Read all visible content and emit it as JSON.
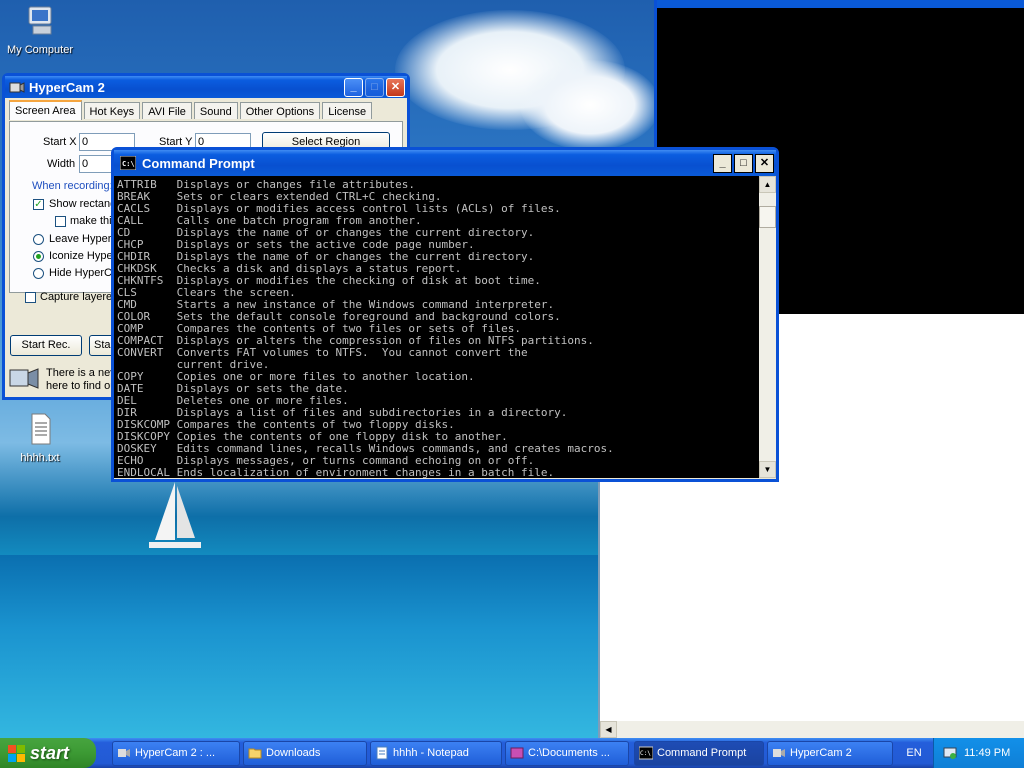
{
  "desktop": {
    "icons": [
      {
        "label": "My Computer"
      },
      {
        "label": "hhhh.txt"
      }
    ]
  },
  "hypercam": {
    "title": "HyperCam 2",
    "tabs": [
      "Screen Area",
      "Hot Keys",
      "AVI File",
      "Sound",
      "Other Options",
      "License"
    ],
    "start_x_label": "Start X",
    "start_x_value": "0",
    "start_y_label": "Start Y",
    "start_y_value": "0",
    "width_label": "Width",
    "width_value": "0",
    "select_region_label": "Select Region",
    "when_recording_label": "When recording:",
    "show_rect_label": "Show rectang",
    "make_this_label": "make this",
    "leave_label": "Leave HyperC",
    "iconize_label": "Iconize Hyper",
    "hide_label": "Hide HyperCa",
    "capture_layered_label": "Capture layered",
    "start_rec_label": "Start Rec.",
    "sta_label": "Sta",
    "notice_line1": "There is a nev",
    "notice_line2": "here to find ou"
  },
  "cmd": {
    "title": "Command Prompt",
    "lines": [
      "ATTRIB   Displays or changes file attributes.",
      "BREAK    Sets or clears extended CTRL+C checking.",
      "CACLS    Displays or modifies access control lists (ACLs) of files.",
      "CALL     Calls one batch program from another.",
      "CD       Displays the name of or changes the current directory.",
      "CHCP     Displays or sets the active code page number.",
      "CHDIR    Displays the name of or changes the current directory.",
      "CHKDSK   Checks a disk and displays a status report.",
      "CHKNTFS  Displays or modifies the checking of disk at boot time.",
      "CLS      Clears the screen.",
      "CMD      Starts a new instance of the Windows command interpreter.",
      "COLOR    Sets the default console foreground and background colors.",
      "COMP     Compares the contents of two files or sets of files.",
      "COMPACT  Displays or alters the compression of files on NTFS partitions.",
      "CONVERT  Converts FAT volumes to NTFS.  You cannot convert the",
      "         current drive.",
      "COPY     Copies one or more files to another location.",
      "DATE     Displays or sets the date.",
      "DEL      Deletes one or more files.",
      "DIR      Displays a list of files and subdirectories in a directory.",
      "DISKCOMP Compares the contents of two floppy disks.",
      "DISKCOPY Copies the contents of one floppy disk to another.",
      "DOSKEY   Edits command lines, recalls Windows commands, and creates macros.",
      "ECHO     Displays messages, or turns command echoing on or off.",
      "ENDLOCAL Ends localization of environment changes in a batch file."
    ]
  },
  "taskbar": {
    "start_label": "start",
    "tasks": [
      {
        "label": "HyperCam 2 : ...",
        "icon": "hypercam-icon"
      },
      {
        "label": "Downloads",
        "icon": "folder-icon"
      },
      {
        "label": "hhhh - Notepad",
        "icon": "notepad-icon"
      },
      {
        "label": "C:\\Documents ...",
        "icon": "media-icon"
      },
      {
        "label": "Command Prompt",
        "icon": "cmd-icon"
      },
      {
        "label": "HyperCam 2",
        "icon": "hypercam-icon"
      }
    ],
    "language": "EN",
    "clock": "11:49 PM"
  },
  "colors": {
    "title_blue": "#0a5ad8",
    "console_bg": "#000000",
    "console_fg": "#c0c0c0",
    "start_green": "#3c9a34"
  }
}
